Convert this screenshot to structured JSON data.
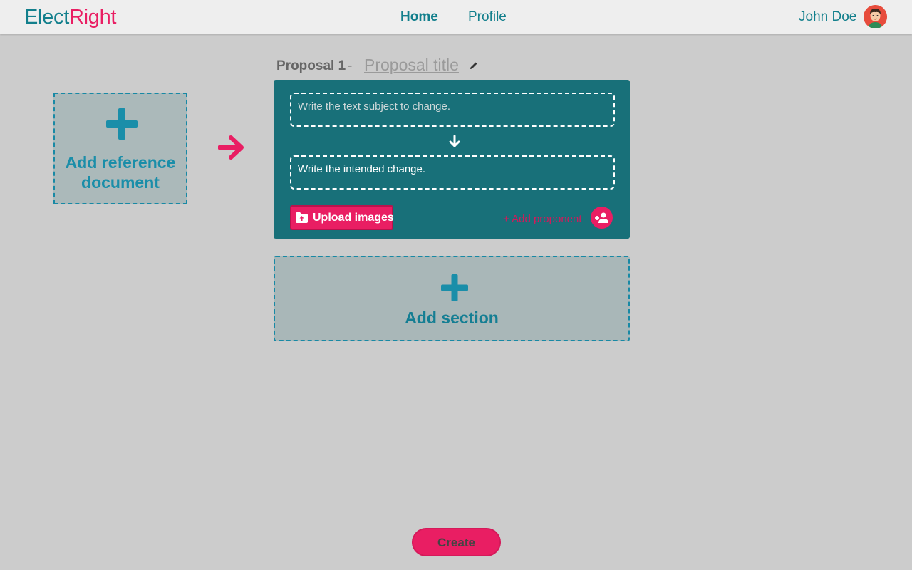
{
  "header": {
    "logo_part1": "Elect",
    "logo_part2": "Right",
    "nav": {
      "home": "Home",
      "profile": "Profile"
    },
    "user_name": "John Doe"
  },
  "reference": {
    "label_line1": "Add reference",
    "label_line2": "document"
  },
  "proposal": {
    "number_label": "Proposal 1",
    "separator": "-",
    "title_placeholder": "Proposal title"
  },
  "section": {
    "subject_placeholder": "Write the text subject to change.",
    "change_placeholder": "Write the intended change.",
    "upload_label": "Upload images",
    "add_proponent_label": "+ Add proponent"
  },
  "add_section_label": "Add section",
  "create_label": "Create",
  "colors": {
    "teal": "#127f8c",
    "pink": "#e91e63",
    "card": "#187079",
    "background": "#cccccc"
  }
}
